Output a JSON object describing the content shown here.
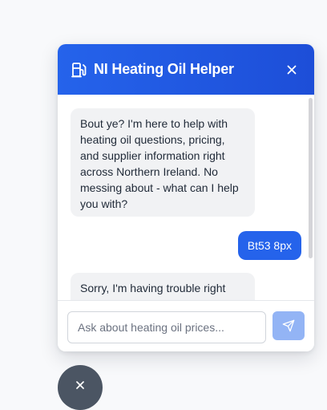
{
  "header": {
    "title": "NI Heating Oil Helper",
    "icon": "fuel-pump-icon",
    "close_icon": "close-icon",
    "color": "#2563eb"
  },
  "messages": [
    {
      "role": "bot",
      "text": "Bout ye? I'm here to help with heating oil questions, pricing, and supplier information right across Northern Ireland. No messing about - what can I help you with?"
    },
    {
      "role": "user",
      "text": "Bt53 8px"
    },
    {
      "role": "bot",
      "text": "Sorry, I'm having trouble right"
    }
  ],
  "input": {
    "placeholder": "Ask about heating oil prices...",
    "value": ""
  },
  "send": {
    "icon": "send-icon"
  },
  "fab": {
    "icon": "close-icon",
    "color": "#4b5563"
  }
}
